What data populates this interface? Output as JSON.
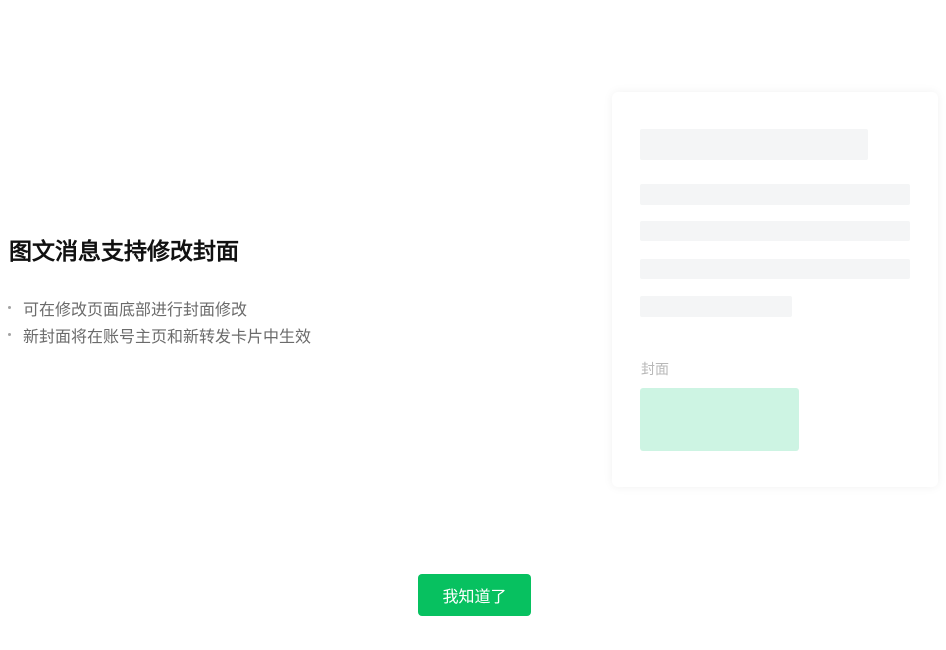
{
  "guide": {
    "title": "图文消息支持修改封面",
    "tips": [
      "可在修改页面底部进行封面修改",
      "新封面将在账号主页和新转发卡片中生效"
    ]
  },
  "preview": {
    "cover_label": "封面"
  },
  "actions": {
    "confirm_label": "我知道了"
  },
  "colors": {
    "accent": "#07c160",
    "cover_placeholder": "#cdf4e3",
    "skeleton": "#f4f5f6"
  }
}
